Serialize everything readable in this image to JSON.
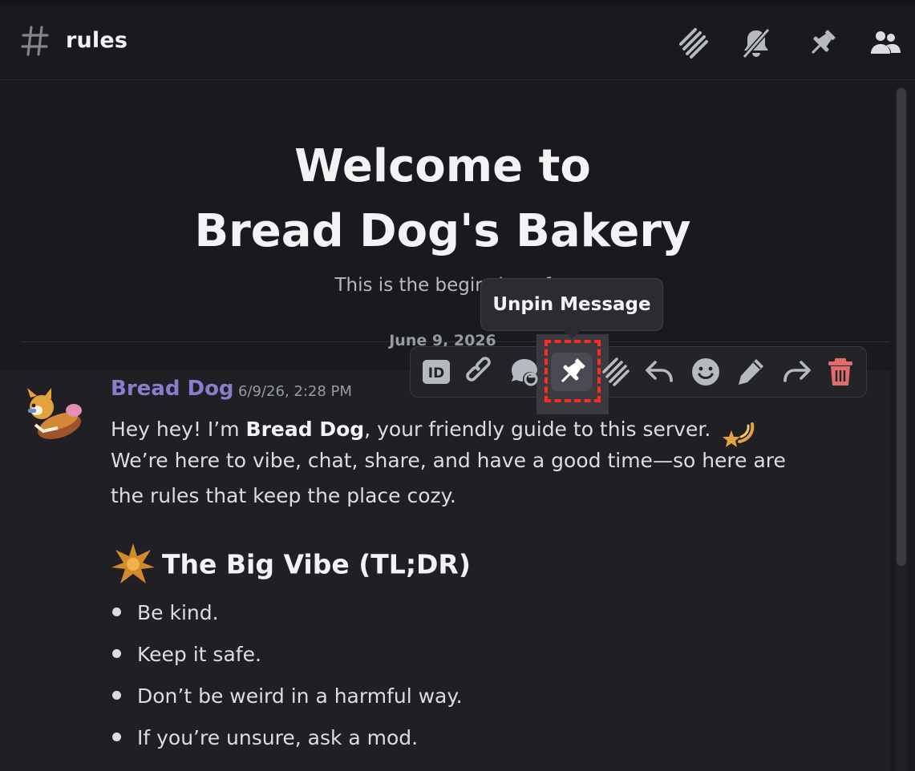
{
  "header": {
    "channel_name": "rules",
    "icons": [
      "threads-icon",
      "notifications-muted-icon",
      "pinned-messages-icon",
      "member-list-icon"
    ]
  },
  "welcome": {
    "title_line1": "Welcome to",
    "title_line2": "Bread Dog's Bakery",
    "subtitle": "This is the beginning of"
  },
  "date_divider": "June 9, 2026",
  "tooltip": "Unpin Message",
  "toolbar": {
    "buttons": [
      "copy-id-icon",
      "copy-link-icon",
      "mark-unread-icon",
      "unpin-icon",
      "create-thread-icon",
      "reply-icon",
      "add-reaction-icon",
      "edit-icon",
      "forward-icon",
      "delete-icon"
    ]
  },
  "message": {
    "author": "Bread Dog",
    "timestamp": "6/9/26, 2:28 PM",
    "line1_pre": "Hey hey! I’m ",
    "line1_bold": "Bread Dog",
    "line1_post": ", your friendly guide to this server.",
    "line2": "We’re here to vibe, chat, share, and have a good time—so here are",
    "line3": "the rules that keep the place cozy.",
    "heading": "The Big Vibe (TL;DR)",
    "bullets": [
      "Be kind.",
      "Keep it safe.",
      "Don’t be weird in a harmful way.",
      "If you’re unsure, ask a mod."
    ]
  },
  "colors": {
    "background": "#1a1a1e",
    "author": "#8d7bcc",
    "highlight_dash": "#ff2b1f",
    "delete": "#e06c6c"
  }
}
